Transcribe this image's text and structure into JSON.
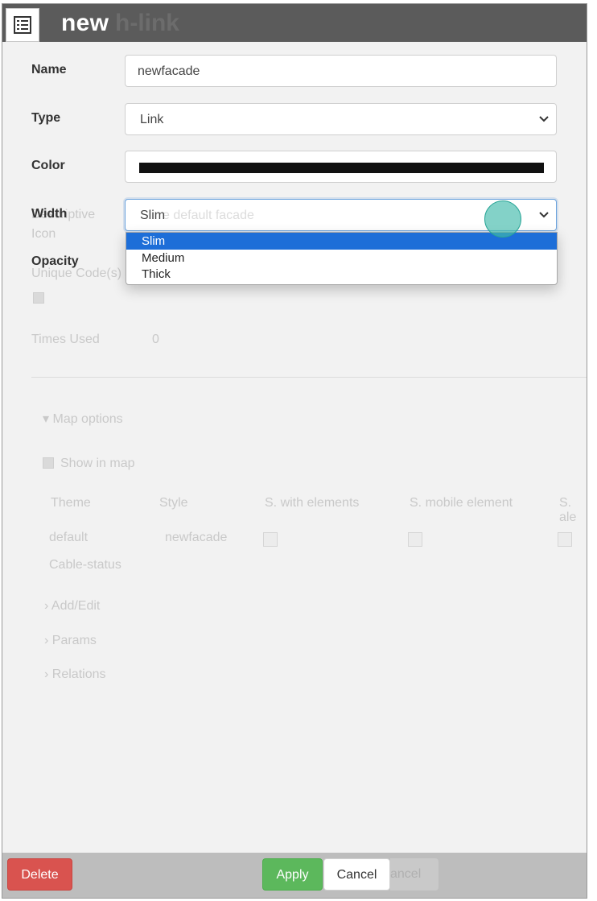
{
  "window": {
    "title": "new",
    "title_ghost": "h-link"
  },
  "form": {
    "name": {
      "label": "Name",
      "value": "newfacade"
    },
    "type": {
      "label": "Type",
      "value": "Link"
    },
    "color": {
      "label": "Color",
      "value_hex": "#111111"
    },
    "width": {
      "label": "Width",
      "value": "Slim",
      "ghost_text": "e default facade",
      "options": [
        "Slim",
        "Medium",
        "Thick"
      ],
      "selected_index": 0
    },
    "opacity": {
      "label": "Opacity"
    }
  },
  "background_ghost": {
    "descriptive": "Descriptive",
    "icon": "Icon",
    "unique_code": "Unique Code(s)",
    "times_used_label": "Times Used",
    "times_used_value": "0",
    "map_options": "Map options",
    "show_in_map": "Show in map",
    "columns": [
      "Theme",
      "Style",
      "S. with elements",
      "S. mobile element",
      "S. ale"
    ],
    "row_theme": "default",
    "row_style": "newfacade",
    "row_theme_2": "Cable-status",
    "sections": [
      "Add/Edit",
      "Params",
      "Relations"
    ]
  },
  "footer": {
    "delete_label": "Delete",
    "apply_label": "Apply",
    "cancel_label": "Cancel",
    "ghost_cancel": "ancel"
  },
  "colors": {
    "titlebar": "#5b5b5b",
    "delete": "#d9534f",
    "apply": "#5cb85c",
    "selected_option": "#1d6ed8"
  }
}
